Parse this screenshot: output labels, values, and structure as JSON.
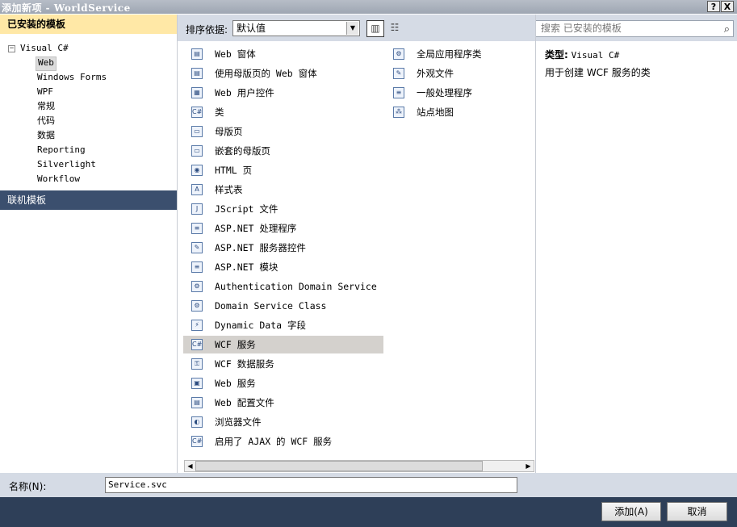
{
  "window": {
    "title": "添加新项 - WorldService",
    "help_label": "?",
    "close_label": "X"
  },
  "left": {
    "installed_header": "已安装的模板",
    "root_expander": "−",
    "root_label": "Visual C#",
    "items": [
      "Web",
      "Windows Forms",
      "WPF",
      "常规",
      "代码",
      "数据",
      "Reporting",
      "Silverlight",
      "Workflow"
    ],
    "online_header": "联机模板"
  },
  "toolbar": {
    "sort_label": "排序依据:",
    "sort_value": "默认值",
    "search_placeholder": "搜索 已安装的模板"
  },
  "templates_col1": [
    {
      "label": "Web 窗体",
      "icon": "web-form-icon"
    },
    {
      "label": "使用母版页的 Web 窗体",
      "icon": "web-form-master-icon"
    },
    {
      "label": "Web 用户控件",
      "icon": "user-control-icon"
    },
    {
      "label": "类",
      "icon": "class-icon"
    },
    {
      "label": "母版页",
      "icon": "master-page-icon"
    },
    {
      "label": "嵌套的母版页",
      "icon": "nested-master-page-icon"
    },
    {
      "label": "HTML 页",
      "icon": "html-page-icon"
    },
    {
      "label": "样式表",
      "icon": "stylesheet-icon"
    },
    {
      "label": "JScript 文件",
      "icon": "jscript-icon"
    },
    {
      "label": "ASP.NET 处理程序",
      "icon": "handler-icon"
    },
    {
      "label": "ASP.NET 服务器控件",
      "icon": "server-control-icon"
    },
    {
      "label": "ASP.NET 模块",
      "icon": "module-icon"
    },
    {
      "label": "Authentication Domain Service",
      "icon": "auth-domain-service-icon"
    },
    {
      "label": "Domain Service Class",
      "icon": "domain-service-icon"
    },
    {
      "label": "Dynamic Data 字段",
      "icon": "dynamic-data-icon"
    },
    {
      "label": "WCF 服务",
      "icon": "wcf-service-icon"
    },
    {
      "label": "WCF 数据服务",
      "icon": "wcf-data-service-icon"
    },
    {
      "label": "Web 服务",
      "icon": "web-service-icon"
    },
    {
      "label": "Web 配置文件",
      "icon": "web-config-icon"
    },
    {
      "label": "浏览器文件",
      "icon": "browser-file-icon"
    },
    {
      "label": "启用了 AJAX 的 WCF 服务",
      "icon": "ajax-wcf-icon"
    }
  ],
  "templates_col2": [
    {
      "label": "全局应用程序类",
      "icon": "global-app-icon"
    },
    {
      "label": "外观文件",
      "icon": "skin-file-icon"
    },
    {
      "label": "一般处理程序",
      "icon": "generic-handler-icon"
    },
    {
      "label": "站点地图",
      "icon": "sitemap-icon"
    }
  ],
  "details": {
    "type_key": "类型:",
    "type_value": "Visual C#",
    "description": "用于创建 WCF 服务的类"
  },
  "name": {
    "label": "名称(N):",
    "value": "Service.svc"
  },
  "footer": {
    "add_label": "添加(A)",
    "cancel_label": "取消"
  }
}
